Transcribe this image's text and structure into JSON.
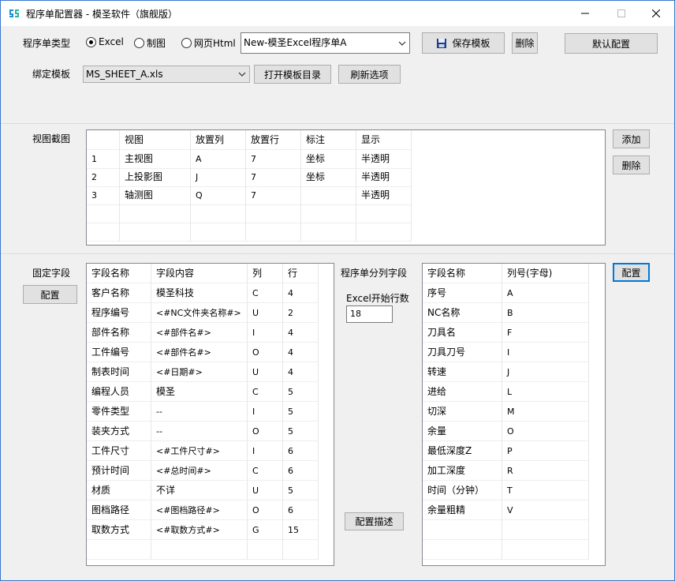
{
  "window": {
    "title": "程序单配置器 - 模圣软件（旗舰版）"
  },
  "top": {
    "type_label": "程序单类型",
    "radios": [
      {
        "label": "Excel",
        "checked": true
      },
      {
        "label": "制图",
        "checked": false
      },
      {
        "label": "网页Html",
        "checked": false
      }
    ],
    "template_combo_value": "New-模圣Excel程序单A",
    "save_template": "保存模板",
    "delete": "删除",
    "default_config": "默认配置",
    "bind_label": "绑定模板",
    "bind_combo_value": "MS_SHEET_A.xls",
    "open_dir": "打开模板目录",
    "refresh": "刷新选项"
  },
  "views": {
    "label": "视图截图",
    "add": "添加",
    "delete": "删除",
    "columns": [
      "",
      "视图",
      "放置列",
      "放置行",
      "标注",
      "显示"
    ],
    "rows": [
      [
        "1",
        "主视图",
        "A",
        "7",
        "坐标",
        "半透明"
      ],
      [
        "2",
        "上投影图",
        "J",
        "7",
        "坐标",
        "半透明"
      ],
      [
        "3",
        "轴测图",
        "Q",
        "7",
        "",
        "半透明"
      ]
    ]
  },
  "fixed": {
    "label": "固定字段",
    "config": "配置",
    "columns": [
      "字段名称",
      "字段内容",
      "列",
      "行"
    ],
    "rows": [
      [
        "客户名称",
        "模圣科技",
        "C",
        "4"
      ],
      [
        "程序编号",
        "<#NC文件夹名称#>",
        "U",
        "2"
      ],
      [
        "部件名称",
        "<#部件名#>",
        "I",
        "4"
      ],
      [
        "工件编号",
        "<#部件名#>",
        "O",
        "4"
      ],
      [
        "制表时间",
        "<#日期#>",
        "U",
        "4"
      ],
      [
        "编程人员",
        "模圣",
        "C",
        "5"
      ],
      [
        "零件类型",
        "--",
        "I",
        "5"
      ],
      [
        "装夹方式",
        "--",
        "O",
        "5"
      ],
      [
        "工件尺寸",
        "<#工件尺寸#>",
        "I",
        "6"
      ],
      [
        "预计时间",
        "<#总时间#>",
        "C",
        "6"
      ],
      [
        "材质",
        "不详",
        "U",
        "5"
      ],
      [
        "图档路径",
        "<#图档路径#>",
        "O",
        "6"
      ],
      [
        "取数方式",
        "<#取数方式#>",
        "G",
        "15"
      ]
    ]
  },
  "split": {
    "label": "程序单分列字段",
    "start_row_label": "Excel开始行数",
    "start_row_value": "18",
    "describe": "配置描述",
    "config": "配置",
    "columns": [
      "字段名称",
      "列号(字母)"
    ],
    "rows": [
      [
        "序号",
        "A"
      ],
      [
        "NC名称",
        "B"
      ],
      [
        "刀具名",
        "F"
      ],
      [
        "刀具刀号",
        "I"
      ],
      [
        "转速",
        "J"
      ],
      [
        "进给",
        "L"
      ],
      [
        "切深",
        "M"
      ],
      [
        "余量",
        "O"
      ],
      [
        "最低深度Z",
        "P"
      ],
      [
        "加工深度",
        "R"
      ],
      [
        "时间（分钟）",
        "T"
      ],
      [
        "余量粗精",
        "V"
      ]
    ]
  },
  "colors": {
    "accent": "#0078d7",
    "titlebar": "#ffffff",
    "window_border": "#3a78c9",
    "face": "#f0f0f0"
  }
}
